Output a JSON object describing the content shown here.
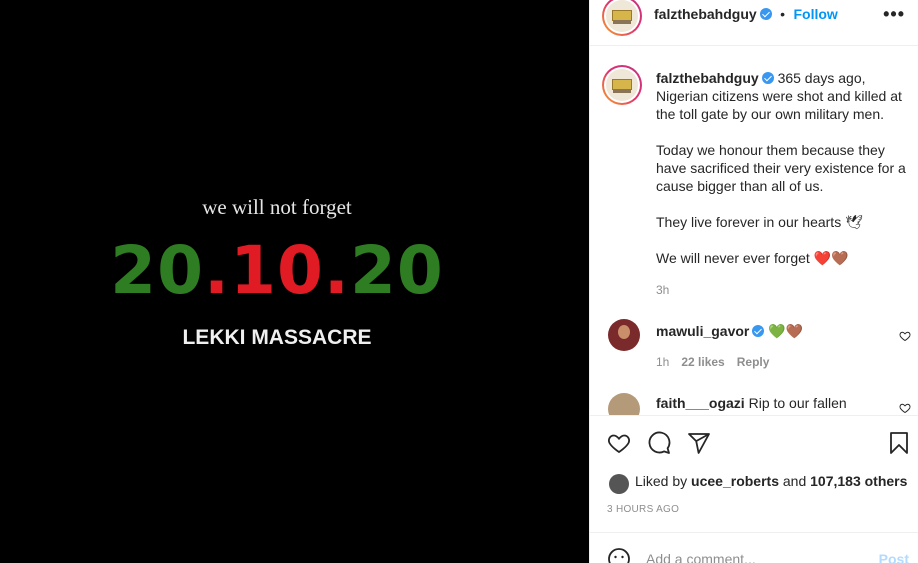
{
  "media": {
    "tagline": "we will not forget",
    "date_parts": [
      "20",
      ".10.",
      "20"
    ],
    "subtitle": "LEKKI MASSACRE"
  },
  "header": {
    "username": "falzthebahdguy",
    "separator": "•",
    "follow_label": "Follow",
    "more_label": "•••"
  },
  "caption": {
    "username": "falzthebahdguy",
    "text": "365 days ago, Nigerian citizens were shot and killed at the toll gate by our own military men.\n\nToday we honour them because they have sacrificed their very existence for a cause bigger than all of us.\n\nThey live forever in our hearts 🕊\n\nWe will never ever forget ❤️🤎",
    "time": "3h"
  },
  "comments": [
    {
      "username": "mawuli_gavor",
      "text": "💚🤎",
      "time": "1h",
      "likes": "22 likes",
      "reply_label": "Reply"
    },
    {
      "username": "faith___ogazi",
      "text": "Rip to our fallen"
    }
  ],
  "likes": {
    "prefix": "Liked by",
    "user": "ucee_roberts",
    "conj": "and",
    "others": "107,183 others"
  },
  "timestamp": "3 HOURS AGO",
  "add_comment": {
    "placeholder": "Add a comment...",
    "post_label": "Post"
  },
  "colors": {
    "accent": "#0095f6",
    "date_green": "#2f7d22",
    "date_red": "#e01b24",
    "muted": "#8e8e8e"
  }
}
